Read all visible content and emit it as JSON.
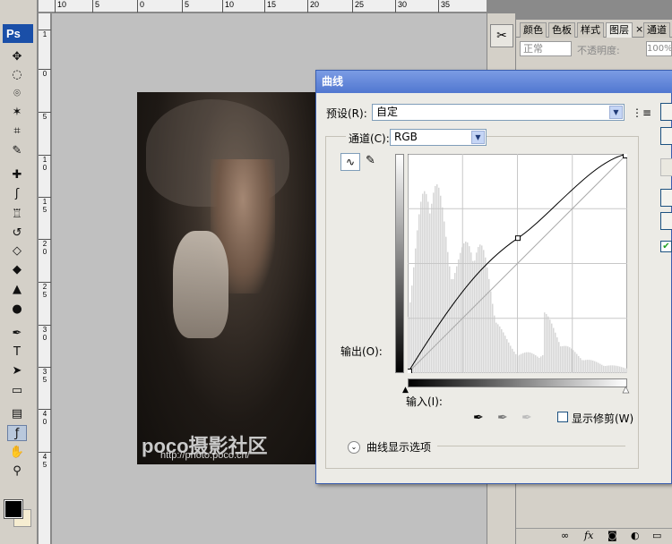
{
  "toolbar": {
    "logo": "Ps",
    "tools": [
      {
        "name": "move-tool",
        "glyph": "✥",
        "icon": "move-icon"
      },
      {
        "name": "marquee-tool",
        "glyph": "◌",
        "icon": "elliptical-marquee-icon"
      },
      {
        "name": "lasso-tool",
        "glyph": "⌾",
        "icon": "lasso-icon"
      },
      {
        "name": "magic-wand-tool",
        "glyph": "✶",
        "icon": "magic-wand-icon"
      },
      {
        "name": "crop-tool",
        "glyph": "⌗",
        "icon": "crop-icon"
      },
      {
        "name": "slice-tool",
        "glyph": "✎",
        "icon": "slice-icon"
      },
      {
        "name": "healing-tool",
        "glyph": "✚",
        "icon": "healing-brush-icon"
      },
      {
        "name": "brush-tool",
        "glyph": "ʃ",
        "icon": "brush-icon"
      },
      {
        "name": "stamp-tool",
        "glyph": "♖",
        "icon": "clone-stamp-icon"
      },
      {
        "name": "history-brush-tool",
        "glyph": "↺",
        "icon": "history-brush-icon"
      },
      {
        "name": "eraser-tool",
        "glyph": "◇",
        "icon": "eraser-icon"
      },
      {
        "name": "paint-bucket-tool",
        "glyph": "◆",
        "icon": "paint-bucket-icon"
      },
      {
        "name": "blur-tool",
        "glyph": "▲",
        "icon": "blur-icon"
      },
      {
        "name": "dodge-tool",
        "glyph": "●",
        "icon": "dodge-icon"
      },
      {
        "name": "pen-tool",
        "glyph": "✒",
        "icon": "pen-icon"
      },
      {
        "name": "type-tool",
        "glyph": "T",
        "icon": "type-icon"
      },
      {
        "name": "path-selection-tool",
        "glyph": "➤",
        "icon": "path-selection-icon"
      },
      {
        "name": "shape-tool",
        "glyph": "▭",
        "icon": "rectangle-shape-icon"
      },
      {
        "name": "notes-tool",
        "glyph": "▤",
        "icon": "notes-icon"
      },
      {
        "name": "eyedropper-tool",
        "glyph": "ƒ",
        "icon": "eyedropper-icon"
      },
      {
        "name": "hand-tool",
        "glyph": "✋",
        "icon": "hand-icon"
      },
      {
        "name": "zoom-tool",
        "glyph": "⚲",
        "icon": "zoom-icon"
      }
    ],
    "foreground_color": "#000000",
    "background_color": "#f6edd1"
  },
  "ruler": {
    "top_labels": [
      "10",
      "5",
      "0",
      "5",
      "10",
      "15",
      "20",
      "25",
      "30",
      "35"
    ],
    "side_labels": [
      "1",
      "0",
      "5",
      "1\n0",
      "1\n5",
      "2\n0",
      "2\n5",
      "3\n0",
      "3\n5",
      "4\n0",
      "4\n5"
    ]
  },
  "canvas": {
    "watermark_logo": "poco摄影社区",
    "watermark_url": "http://photo.poco.cn/"
  },
  "panel": {
    "tabs": [
      "颜色",
      "色板",
      "样式",
      "图层",
      "通道"
    ],
    "active_tab": "图层",
    "close_glyph": "×",
    "blend_mode": "正常",
    "opacity_label": "不透明度:",
    "opacity_value": "100%",
    "bottom_icons": [
      "link-icon",
      "fx-icon",
      "mask-icon",
      "adjustment-icon",
      "folder-icon"
    ]
  },
  "curves_dialog": {
    "title": "曲线",
    "preset_label": "预设(R):",
    "preset_value": "自定",
    "channel_label": "通道(C):",
    "channel_value": "RGB",
    "output_label": "输出(O):",
    "input_label": "输入(I):",
    "show_clipping_label": "显示修剪(W)",
    "curve_display_options": "曲线显示选项",
    "show_clipping_checked": false,
    "preview_checked": true,
    "control_point": {
      "input": 128,
      "output": 157
    }
  }
}
